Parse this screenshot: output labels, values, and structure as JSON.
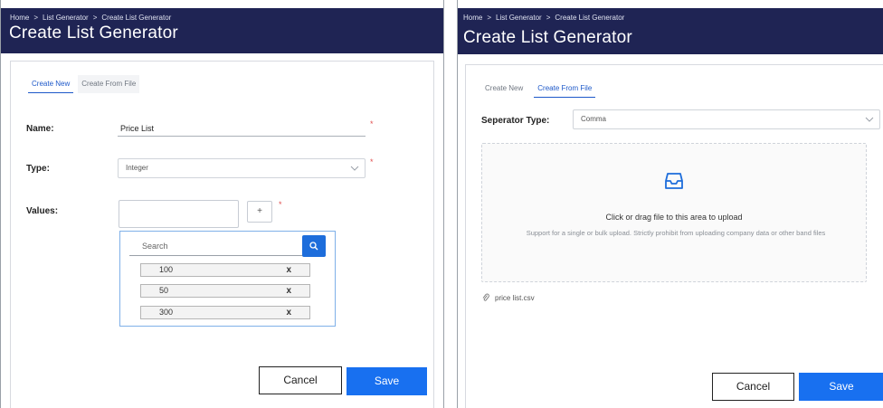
{
  "left": {
    "breadcrumb": [
      "Home",
      ">",
      "List Generator",
      ">",
      "Create List Generator"
    ],
    "title": "Create List Generator",
    "tabs": [
      {
        "label": "Create New",
        "active": true
      },
      {
        "label": "Create From File",
        "active": false
      }
    ],
    "form": {
      "name_label": "Name:",
      "name_value": "Price List",
      "type_label": "Type:",
      "type_value": "Integer",
      "values_label": "Values:",
      "plus_label": "+",
      "required_mark": "*"
    },
    "dropdown": {
      "search_placeholder": "Search",
      "items": [
        "100",
        "50",
        "300"
      ],
      "remove_glyph": "x"
    },
    "buttons": {
      "cancel": "Cancel",
      "save": "Save"
    }
  },
  "right": {
    "breadcrumb": [
      "Home",
      ">",
      "List Generator",
      ">",
      "Create List Generator"
    ],
    "title": "Create List Generator",
    "tabs": [
      {
        "label": "Create New",
        "active": false
      },
      {
        "label": "Create From File",
        "active": true
      }
    ],
    "separator_label": "Seperator Type:",
    "separator_value": "Comma",
    "upload": {
      "icon": "inbox-icon",
      "title": "Click or drag file to this area to upload",
      "hint": "Support for a single or bulk upload. Strictly prohibit from uploading company data or other band files"
    },
    "file_name": "price list.csv",
    "buttons": {
      "cancel": "Cancel",
      "save": "Save"
    }
  },
  "colors": {
    "header_bg": "#1f2454",
    "accent": "#1d6ddb",
    "save_button": "#1870f0",
    "required": "#e05050"
  }
}
